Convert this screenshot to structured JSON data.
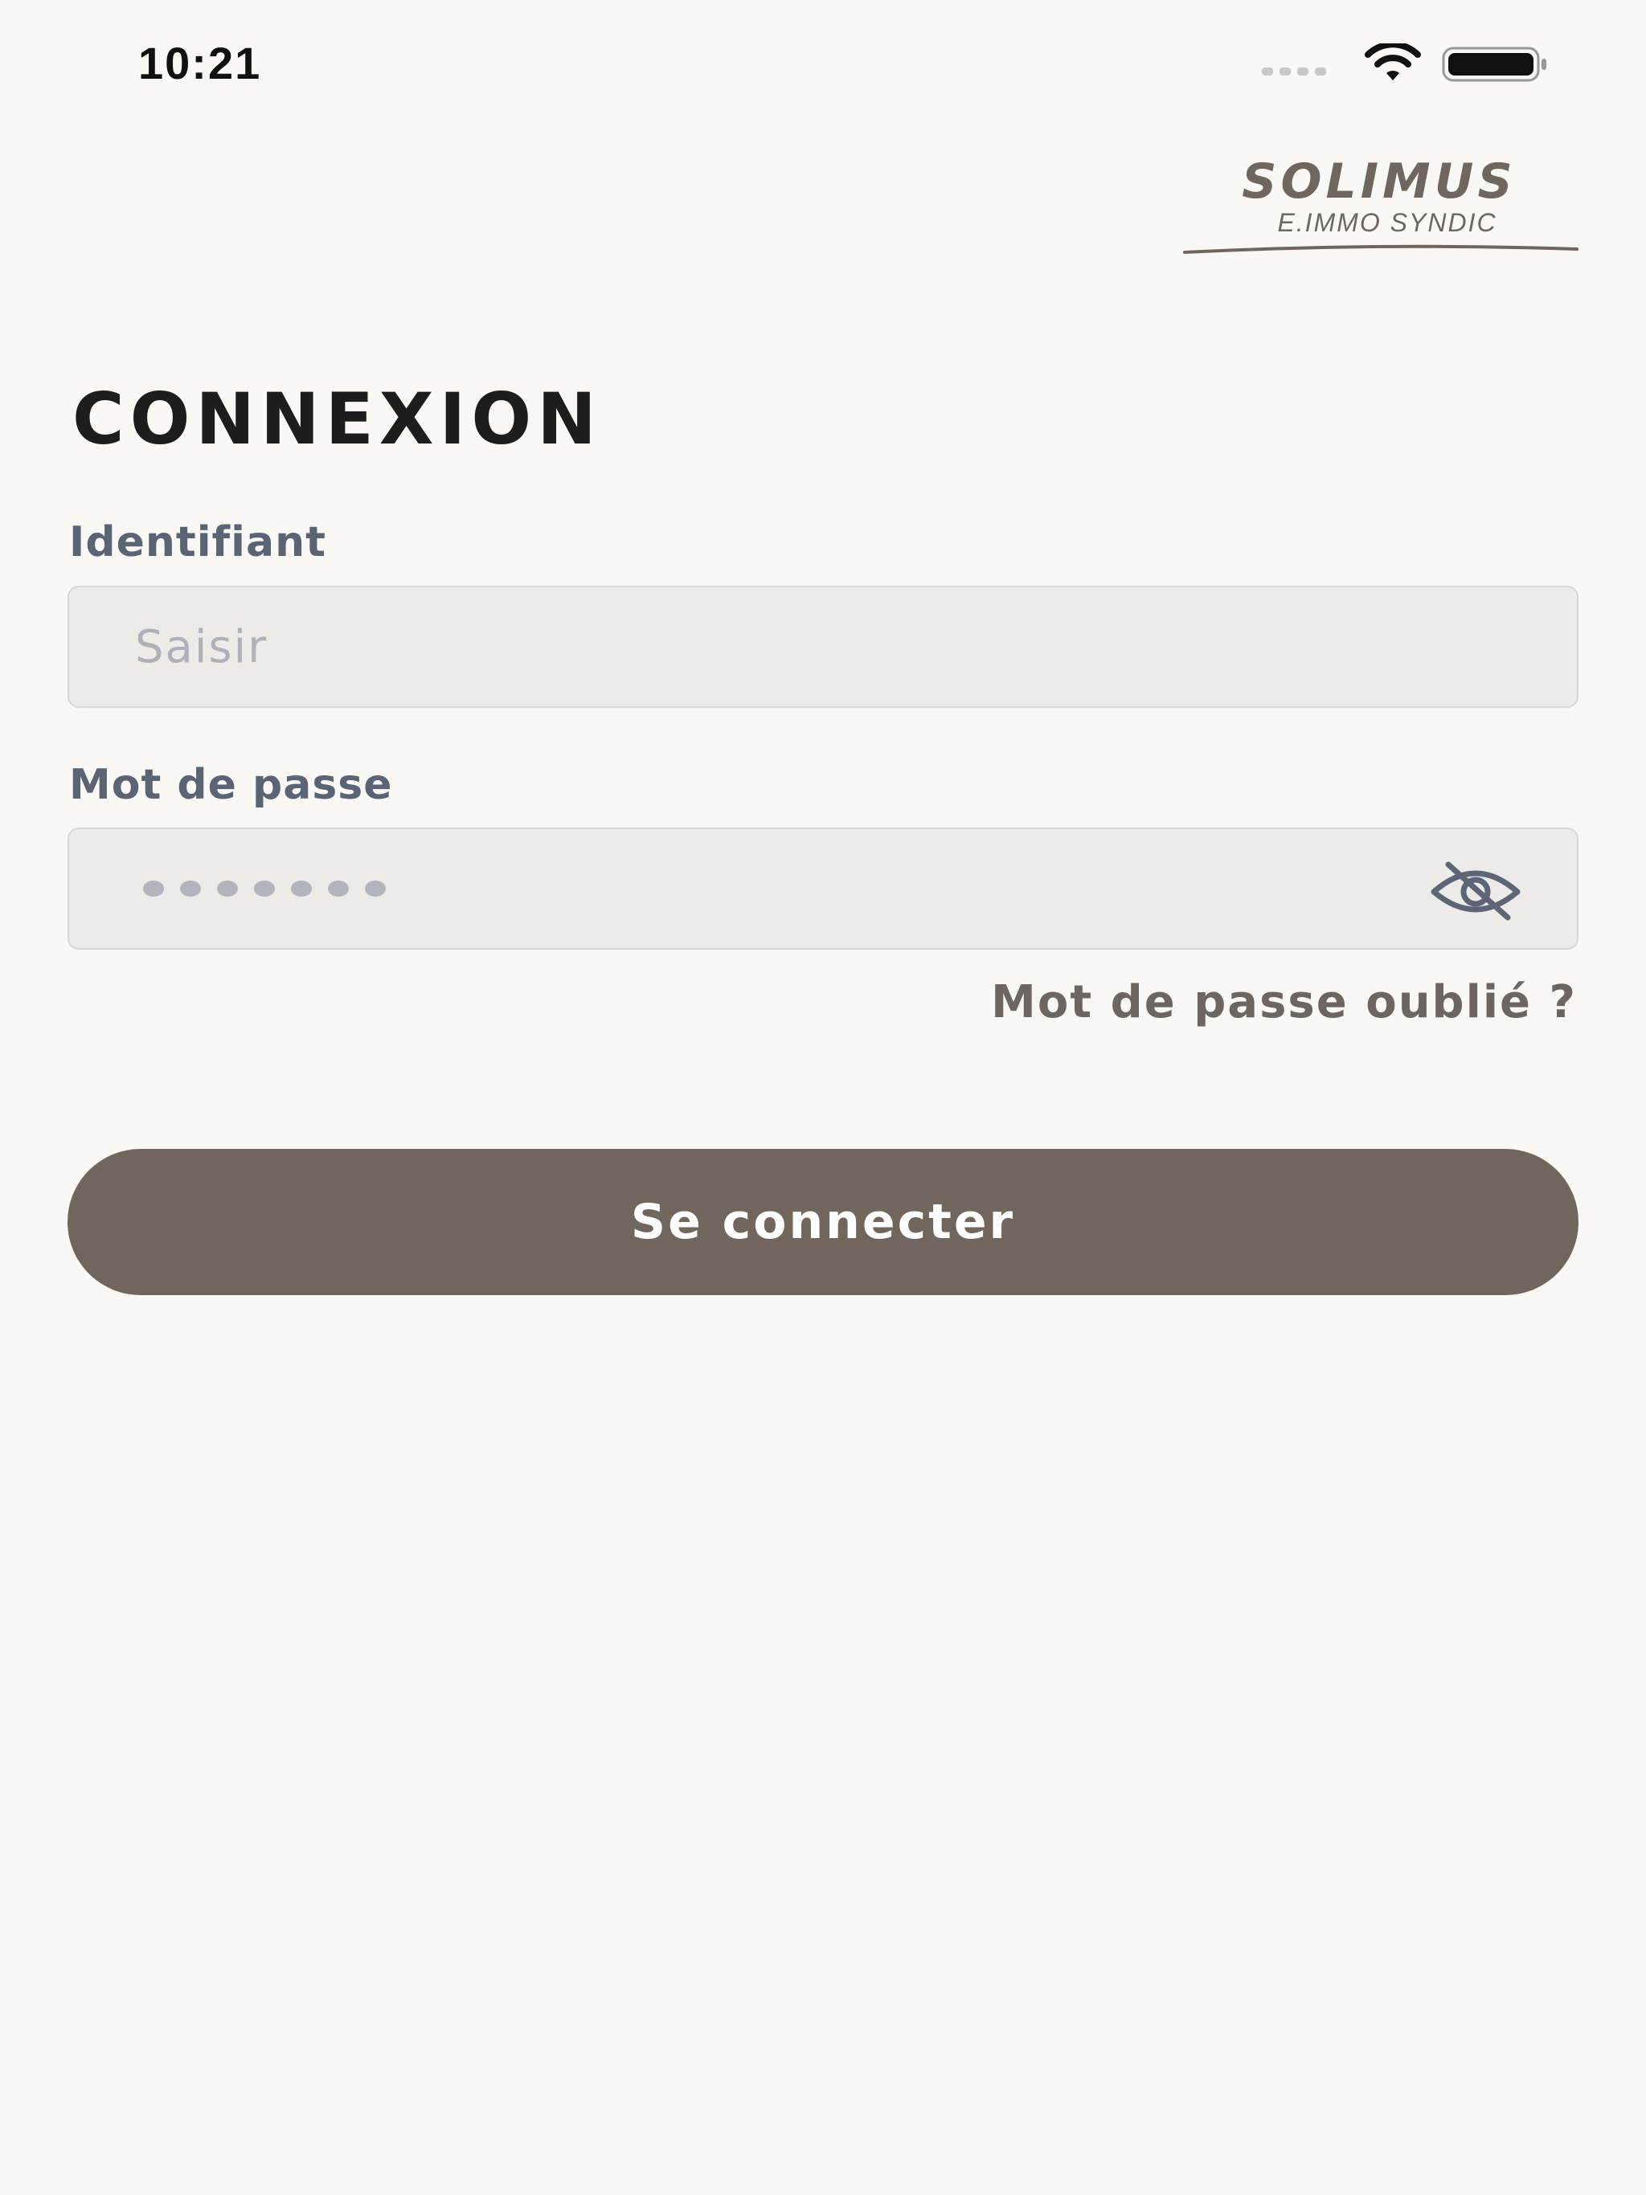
{
  "status_bar": {
    "time": "10:21",
    "wifi_icon": "wifi-icon",
    "battery_icon": "battery-icon",
    "signal_icon": "cellular-signal-icon"
  },
  "brand": {
    "name": "SOLIMUS",
    "tagline": "E.IMMO SYNDIC",
    "color": "#6f675f"
  },
  "login": {
    "title": "CONNEXION",
    "identifier_label": "Identifiant",
    "identifier_placeholder": "Saisir",
    "identifier_value": "",
    "password_label": "Mot de passe",
    "password_masked": true,
    "password_toggle_icon": "eye-off-icon",
    "forgot_password_label": "Mot de passe oublié ?",
    "submit_label": "Se connecter"
  },
  "colors": {
    "background": "#f9f8f4",
    "input_background": "#ecebe7",
    "label": "#5b6475",
    "button": "#70665c",
    "button_text": "#ffffff"
  }
}
